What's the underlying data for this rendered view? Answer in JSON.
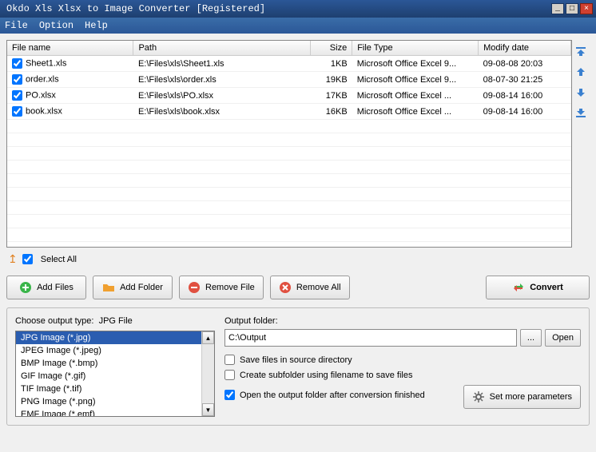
{
  "window": {
    "title": "Okdo Xls Xlsx to Image Converter [Registered]"
  },
  "menu": {
    "file": "File",
    "option": "Option",
    "help": "Help"
  },
  "columns": {
    "name": "File name",
    "path": "Path",
    "size": "Size",
    "type": "File Type",
    "date": "Modify date"
  },
  "files": [
    {
      "checked": true,
      "name": "Sheet1.xls",
      "path": "E:\\Files\\xls\\Sheet1.xls",
      "size": "1KB",
      "type": "Microsoft Office Excel 9...",
      "date": "09-08-08 20:03"
    },
    {
      "checked": true,
      "name": "order.xls",
      "path": "E:\\Files\\xls\\order.xls",
      "size": "19KB",
      "type": "Microsoft Office Excel 9...",
      "date": "08-07-30 21:25"
    },
    {
      "checked": true,
      "name": "PO.xlsx",
      "path": "E:\\Files\\xls\\PO.xlsx",
      "size": "17KB",
      "type": "Microsoft Office Excel ...",
      "date": "09-08-14 16:00"
    },
    {
      "checked": true,
      "name": "book.xlsx",
      "path": "E:\\Files\\xls\\book.xlsx",
      "size": "16KB",
      "type": "Microsoft Office Excel ...",
      "date": "09-08-14 16:00"
    }
  ],
  "selectAll": "Select All",
  "buttons": {
    "addFiles": "Add Files",
    "addFolder": "Add Folder",
    "removeFile": "Remove File",
    "removeAll": "Remove All",
    "convert": "Convert",
    "browse": "...",
    "open": "Open",
    "setParams": "Set more parameters"
  },
  "output": {
    "typeLabelPrefix": "Choose output type:",
    "typeLabelValue": "JPG File",
    "types": [
      "JPG Image (*.jpg)",
      "JPEG Image (*.jpeg)",
      "BMP Image (*.bmp)",
      "GIF Image (*.gif)",
      "TIF Image (*.tif)",
      "PNG Image (*.png)",
      "EMF Image (*.emf)"
    ],
    "folderLabel": "Output folder:",
    "folderValue": "C:\\Output",
    "saveInSource": "Save files in source directory",
    "createSubfolder": "Create subfolder using filename to save files",
    "openAfter": "Open the output folder after conversion finished"
  }
}
